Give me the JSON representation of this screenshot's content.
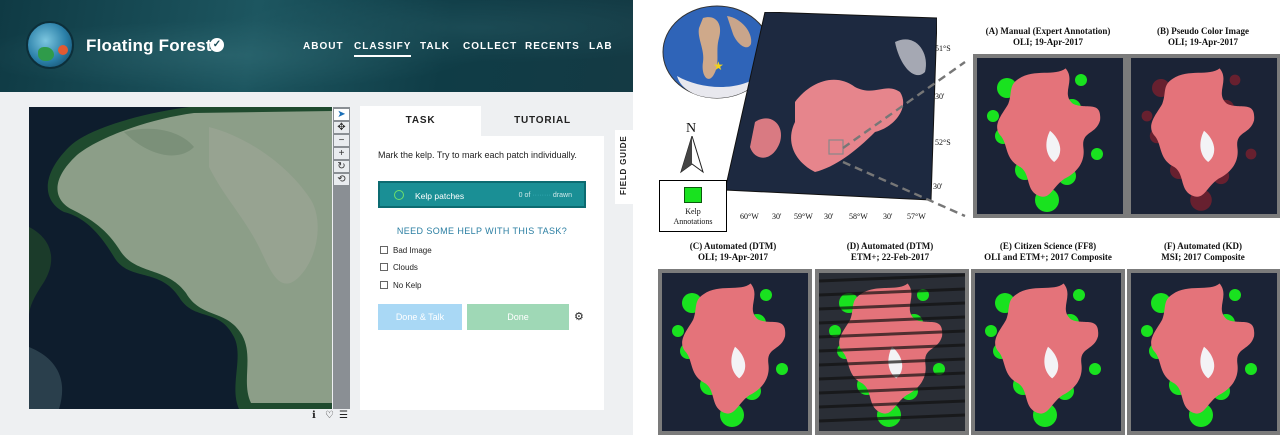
{
  "header": {
    "site_title": "Floating Forests",
    "nav": [
      "ABOUT",
      "CLASSIFY",
      "TALK",
      "COLLECT",
      "RECENTS",
      "LAB"
    ],
    "active_nav": "CLASSIFY"
  },
  "task_panel": {
    "tabs": [
      "TASK",
      "TUTORIAL"
    ],
    "instruction": "Mark the kelp. Try to mark each patch individually.",
    "tool_label": "Kelp patches",
    "tool_count_prefix": "0 of",
    "tool_count_suffix": "drawn",
    "help_heading": "NEED SOME HELP WITH THIS TASK?",
    "checkboxes": [
      "Bad Image",
      "Clouds",
      "No Kelp"
    ],
    "done_talk_label": "Done & Talk",
    "done_label": "Done",
    "field_guide_label": "FIELD GUIDE"
  },
  "figure": {
    "captions": [
      {
        "line1": "(A) Manual (Expert Annotation)",
        "line2": "OLI; 19-Apr-2017"
      },
      {
        "line1": "(B) Pseudo Color Image",
        "line2": "OLI; 19-Apr-2017"
      },
      {
        "line1": "(C) Automated (DTM)",
        "line2": "OLI; 19-Apr-2017"
      },
      {
        "line1": "(D) Automated (DTM)",
        "line2": "ETM+; 22-Feb-2017"
      },
      {
        "line1": "(E) Citizen Science (FF8)",
        "line2": "OLI and ETM+; 2017 Composite"
      },
      {
        "line1": "(F) Automated (KD)",
        "line2": "MSI; 2017 Composite"
      }
    ],
    "lat_labels": [
      "51°S",
      "30'",
      "52°S",
      "30'"
    ],
    "lon_labels": [
      "60°W",
      "30'",
      "59°W",
      "30'",
      "58°W",
      "30'",
      "57°W"
    ],
    "north_label": "N",
    "legend_line1": "Kelp",
    "legend_line2": "Annotations",
    "colors": {
      "kelp": "#19e21f",
      "land": "#e4737a",
      "water": "#1b2336"
    }
  }
}
